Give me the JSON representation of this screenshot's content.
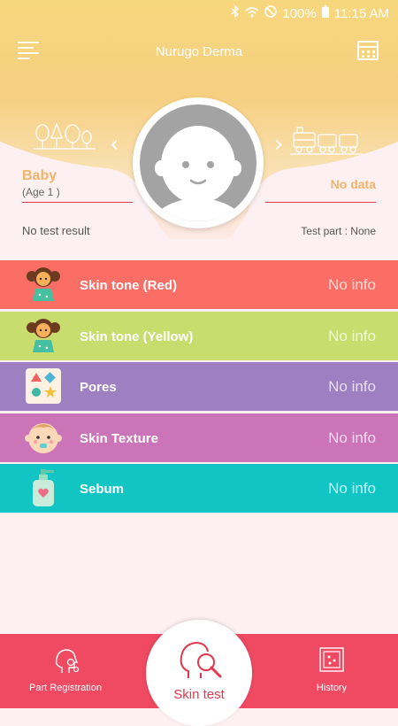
{
  "status_bar": {
    "battery": "100%",
    "time": "11:15 AM"
  },
  "header": {
    "title": "Nurugo Derma"
  },
  "profile": {
    "name": "Baby",
    "age": "(Age 1  )",
    "result_value": "No data",
    "test_result": "No test result",
    "test_part": "Test part : None"
  },
  "skin_items": [
    {
      "label": "Skin tone (Red)",
      "value": "No info",
      "color": "#fb6e65"
    },
    {
      "label": "Skin tone (Yellow)",
      "value": "No info",
      "color": "#c9dc6e"
    },
    {
      "label": "Pores",
      "value": "No info",
      "color": "#9e7fc2"
    },
    {
      "label": "Skin Texture",
      "value": "No info",
      "color": "#cb75b8"
    },
    {
      "label": "Sebum",
      "value": "No info",
      "color": "#12c5c5"
    }
  ],
  "bottom_nav": {
    "part_registration": "Part Registration",
    "skin_test": "Skin test",
    "history": "History"
  },
  "colors": {
    "accent": "#ef4a62",
    "header_yellow": "#f6cf80",
    "label_orange": "#f2b36b"
  }
}
